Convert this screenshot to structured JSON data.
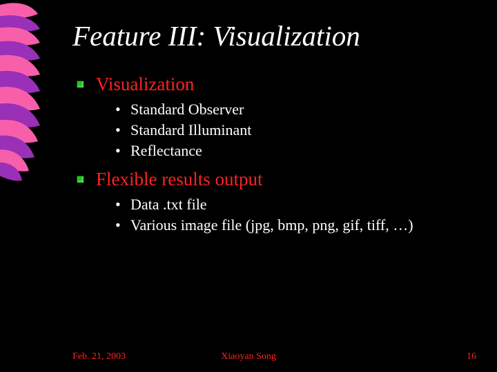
{
  "title": "Feature III: Visualization",
  "items": [
    {
      "label": "Visualization",
      "sub": [
        "Standard Observer",
        "Standard Illuminant",
        "Reflectance"
      ]
    },
    {
      "label": "Flexible results output",
      "sub": [
        "Data .txt file",
        "Various image file (jpg, bmp, png, gif, tiff, …)"
      ]
    }
  ],
  "footer": {
    "date": "Feb. 21, 2003",
    "author": "Xiaoyan Song",
    "page": "16"
  },
  "decor": {
    "pink": "#f85faa",
    "purple": "#9a2fb8"
  }
}
